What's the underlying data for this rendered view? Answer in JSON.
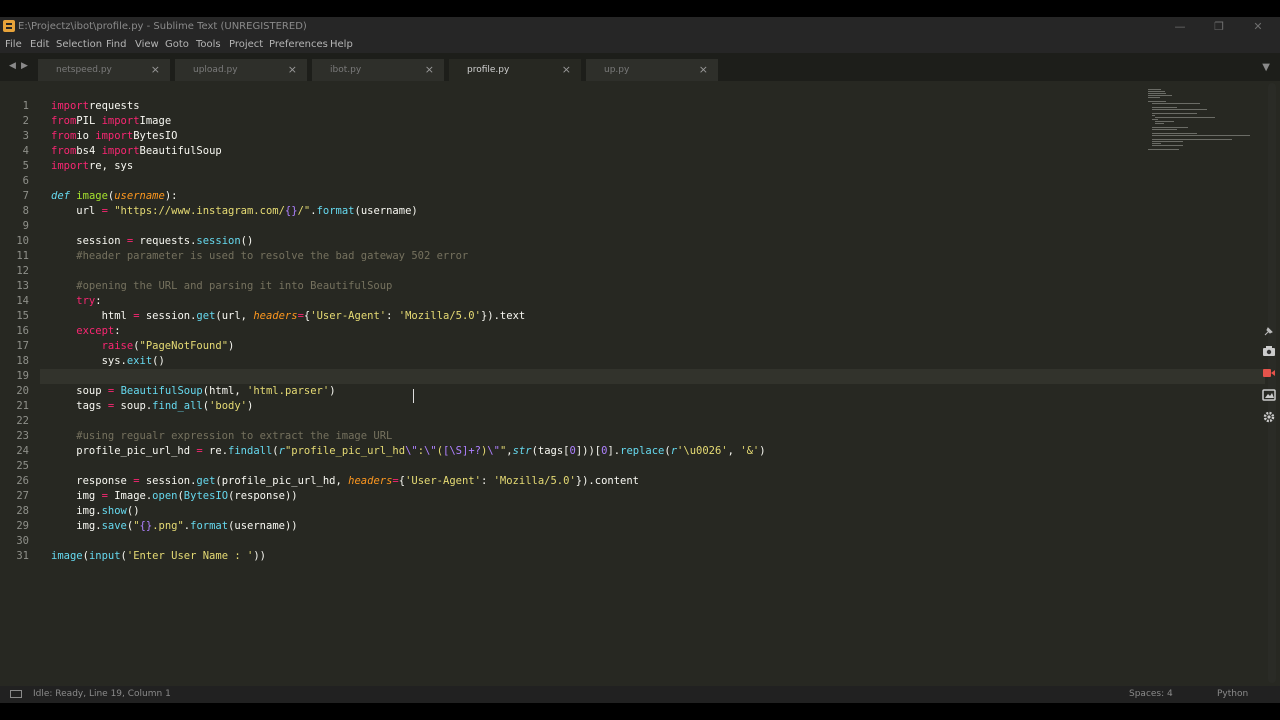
{
  "window": {
    "title": "E:\\Projectz\\ibot\\profile.py - Sublime Text (UNREGISTERED)",
    "minimize": "—",
    "maximize": "❐",
    "close": "✕"
  },
  "menu": [
    "File",
    "Edit",
    "Selection",
    "Find",
    "View",
    "Goto",
    "Tools",
    "Project",
    "Preferences",
    "Help"
  ],
  "tabs": [
    {
      "label": "netspeed.py",
      "active": false
    },
    {
      "label": "upload.py",
      "active": false
    },
    {
      "label": "ibot.py",
      "active": false
    },
    {
      "label": "profile.py",
      "active": true
    },
    {
      "label": "up.py",
      "active": false
    }
  ],
  "tab_close_glyph": "×",
  "editor": {
    "current_line": 19,
    "lines": [
      [
        [
          "k",
          "import"
        ],
        [
          "",
          "requests"
        ]
      ],
      [
        [
          "k",
          "from"
        ],
        [
          "",
          "PIL "
        ],
        [
          "k",
          "import"
        ],
        [
          "",
          "Image"
        ]
      ],
      [
        [
          "k",
          "from"
        ],
        [
          "",
          "io "
        ],
        [
          "k",
          "import"
        ],
        [
          "",
          "BytesIO"
        ]
      ],
      [
        [
          "k",
          "from"
        ],
        [
          "",
          "bs4 "
        ],
        [
          "k",
          "import"
        ],
        [
          "",
          "BeautifulSoup"
        ]
      ],
      [
        [
          "k",
          "import"
        ],
        [
          "",
          "re, sys"
        ]
      ],
      [],
      [
        [
          "i",
          "def"
        ],
        [
          "",
          " "
        ],
        [
          "g",
          "image"
        ],
        [
          "",
          "("
        ],
        [
          "p",
          "username"
        ],
        [
          "",
          "):"
        ]
      ],
      [
        [
          "",
          "    url "
        ],
        [
          "k",
          "="
        ],
        [
          "",
          " "
        ],
        [
          "s",
          "\"https://www.instagram.com/"
        ],
        [
          "n",
          "{}"
        ],
        [
          "s",
          "/\""
        ],
        [
          "",
          "."
        ],
        [
          "f",
          "format"
        ],
        [
          "",
          "(username)"
        ]
      ],
      [],
      [
        [
          "",
          "    session "
        ],
        [
          "k",
          "="
        ],
        [
          "",
          "",
          " requests."
        ],
        [
          "f",
          "session"
        ],
        [
          "",
          "()"
        ]
      ],
      [
        [
          "c",
          "    #header parameter is used to resolve the bad gateway 502 error"
        ]
      ],
      [],
      [
        [
          "c",
          "    #opening the URL and parsing it into BeautifulSoup"
        ]
      ],
      [
        [
          "k",
          "    try"
        ],
        [
          "",
          ":"
        ]
      ],
      [
        [
          "",
          "        html "
        ],
        [
          "k",
          "="
        ],
        [
          "",
          " session."
        ],
        [
          "f",
          "get"
        ],
        [
          "",
          "(url, "
        ],
        [
          "p",
          "headers"
        ],
        [
          "k",
          "="
        ],
        [
          "",
          "{"
        ],
        [
          "s",
          "'User-Agent'"
        ],
        [
          "",
          ": "
        ],
        [
          "s",
          "'Mozilla/5.0'"
        ],
        [
          "",
          "})."
        ],
        [
          "",
          "text"
        ]
      ],
      [
        [
          "k",
          "    except"
        ],
        [
          "",
          ":"
        ]
      ],
      [
        [
          "k",
          "        raise"
        ],
        [
          "",
          "("
        ],
        [
          "s",
          "\"PageNotFound\""
        ],
        [
          "",
          ")"
        ]
      ],
      [
        [
          "",
          "        sys."
        ],
        [
          "f",
          "exit"
        ],
        [
          "",
          "()"
        ]
      ],
      [],
      [
        [
          "",
          "    soup "
        ],
        [
          "k",
          "="
        ],
        [
          "",
          " "
        ],
        [
          "f",
          "BeautifulSoup"
        ],
        [
          "",
          "(html, "
        ],
        [
          "s",
          "'html.parser'"
        ],
        [
          "",
          ")"
        ]
      ],
      [
        [
          "",
          "    tags "
        ],
        [
          "k",
          "="
        ],
        [
          "",
          " soup."
        ],
        [
          "f",
          "find_all"
        ],
        [
          "",
          "("
        ],
        [
          "s",
          "'body'"
        ],
        [
          "",
          ")"
        ]
      ],
      [],
      [
        [
          "c",
          "    #using regualr expression to extract the image URL"
        ]
      ],
      [
        [
          "",
          "    profile_pic_url_hd "
        ],
        [
          "k",
          "="
        ],
        [
          "",
          " re."
        ],
        [
          "f",
          "findall"
        ],
        [
          "",
          "("
        ],
        [
          "i",
          "r"
        ],
        [
          "s",
          "\"profile_pic_url_hd"
        ],
        [
          "n",
          "\\\""
        ],
        [
          "s",
          ":"
        ],
        [
          "n",
          "\\\""
        ],
        [
          "s",
          "("
        ],
        [
          "n",
          "[\\S]+?"
        ],
        [
          "s",
          ")"
        ],
        [
          "n",
          "\\\""
        ],
        [
          "s",
          "\""
        ],
        [
          "",
          ","
        ],
        [
          "d",
          "str"
        ],
        [
          "",
          "(tags["
        ],
        [
          "n",
          "0"
        ],
        [
          "",
          "]))["
        ],
        [
          "n",
          "0"
        ],
        [
          "",
          "]."
        ],
        [
          "f",
          "replace"
        ],
        [
          "",
          "("
        ],
        [
          "i",
          "r"
        ],
        [
          "s",
          "'\\u0026'"
        ],
        [
          "",
          ", "
        ],
        [
          "s",
          "'&'"
        ],
        [
          "",
          ")"
        ]
      ],
      [],
      [
        [
          "",
          "    response "
        ],
        [
          "k",
          "="
        ],
        [
          "",
          " session."
        ],
        [
          "f",
          "get"
        ],
        [
          "",
          "(profile_pic_url_hd, "
        ],
        [
          "p",
          "headers"
        ],
        [
          "k",
          "="
        ],
        [
          "",
          "{"
        ],
        [
          "s",
          "'User-Agent'"
        ],
        [
          "",
          ": "
        ],
        [
          "s",
          "'Mozilla/5.0'"
        ],
        [
          "",
          "})."
        ],
        [
          "",
          "content"
        ]
      ],
      [
        [
          "",
          "    img "
        ],
        [
          "k",
          "="
        ],
        [
          "",
          " Image."
        ],
        [
          "f",
          "open"
        ],
        [
          "",
          "("
        ],
        [
          "f",
          "BytesIO"
        ],
        [
          "",
          "(response))"
        ]
      ],
      [
        [
          "",
          "    img."
        ],
        [
          "f",
          "show"
        ],
        [
          "",
          "()"
        ]
      ],
      [
        [
          "",
          "    img."
        ],
        [
          "f",
          "save"
        ],
        [
          "",
          "("
        ],
        [
          "s",
          "\""
        ],
        [
          "n",
          "{}"
        ],
        [
          "s",
          ".png\""
        ],
        [
          "",
          "."
        ],
        [
          "f",
          "format"
        ],
        [
          "",
          "(username))"
        ]
      ],
      [],
      [
        [
          "f",
          "image"
        ],
        [
          "",
          "("
        ],
        [
          "f",
          "input"
        ],
        [
          "",
          "("
        ],
        [
          "s",
          "'Enter User Name : '"
        ],
        [
          "",
          "))"
        ]
      ]
    ]
  },
  "status": {
    "left": "Idle: Ready, Line 19, Column 1",
    "spaces": "Spaces: 4",
    "syntax": "Python"
  }
}
